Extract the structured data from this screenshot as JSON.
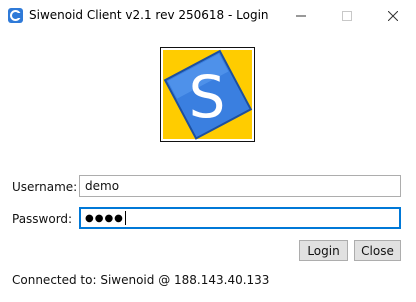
{
  "window": {
    "title": "Siwenoid Client v2.1 rev 250618 - Login",
    "controls": {
      "minimize": "minimize-icon",
      "maximize": "maximize-icon",
      "close": "close-icon"
    }
  },
  "logo": {
    "letter": "S",
    "colors": {
      "background": "#ffcc00",
      "tile": "#3a7fe0"
    }
  },
  "form": {
    "username_label": "Username:",
    "username_value": "demo",
    "password_label": "Password:",
    "password_mask": "●●●●"
  },
  "buttons": {
    "login": "Login",
    "close": "Close"
  },
  "status": {
    "text": "Connected to:  Siwenoid @ 188.143.40.133"
  },
  "colors": {
    "focus_border": "#0078d7",
    "button_bg": "#e1e1e1"
  }
}
